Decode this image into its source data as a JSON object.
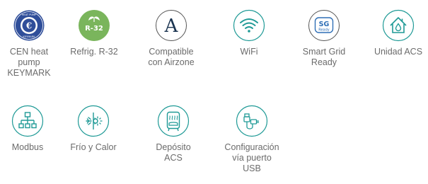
{
  "features": [
    {
      "icon": "keymark-badge-icon",
      "label": "CEN heat\npump\nKEYMARK",
      "badge_top": "HEAT PUMP",
      "badge_bottom": "KEYMARK"
    },
    {
      "icon": "refrigerant-r32-icon",
      "label": "Refrig. R-32",
      "badge_text": "R-32"
    },
    {
      "icon": "airzone-logo-icon",
      "label": "Compatible\ncon Airzone",
      "glyph": "A"
    },
    {
      "icon": "wifi-icon",
      "label": "WiFi"
    },
    {
      "icon": "smart-grid-icon",
      "label": "Smart Grid\nReady",
      "badge_main": "SG",
      "badge_sub": "Ready"
    },
    {
      "icon": "house-water-drop-icon",
      "label": "Unidad ACS"
    },
    {
      "icon": "network-tree-icon",
      "label": "Modbus"
    },
    {
      "icon": "heat-cool-icon",
      "label": "Frío y Calor"
    },
    {
      "icon": "water-tank-icon",
      "label": "Depósito\nACS"
    },
    {
      "icon": "usb-plug-icon",
      "label": "Configuración\nvía puerto\nUSB"
    }
  ],
  "colors": {
    "accent": "#1f9a96",
    "label_text": "#6b6b6b",
    "keymark_blue": "#2f4e9a",
    "r32_green": "#7ab55c",
    "airzone_navy": "#1a3350",
    "sg_blue": "#2f6fb6"
  }
}
